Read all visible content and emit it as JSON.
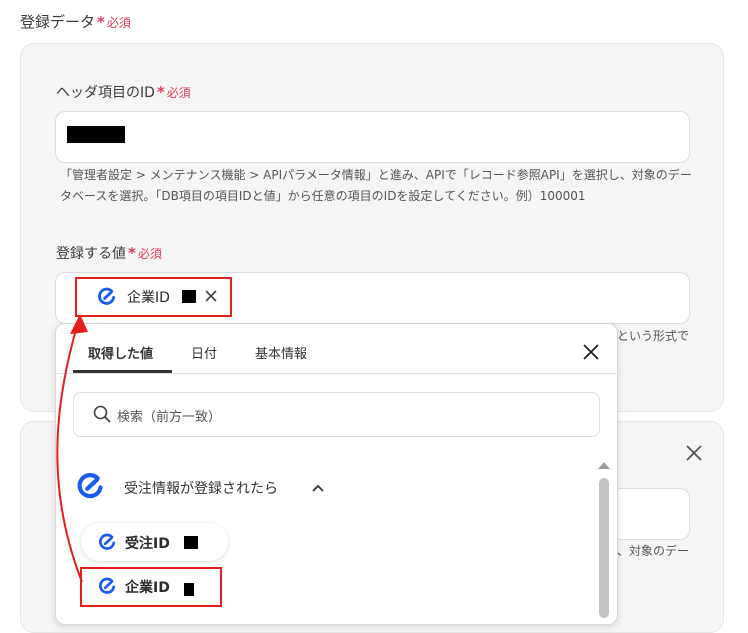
{
  "section": {
    "title": "登録データ",
    "required_label": "必須"
  },
  "header_id": {
    "label": "ヘッダ項目のID",
    "required_label": "必須",
    "hint_line1": "「管理者設定 > メンテナンス機能 > APIパラメータ情報」と進み、APIで「レコード参照API」を選択し、対象のデー",
    "hint_line2": "タベースを選択。「DB項目の項目IDと値」から任意の項目のIDを設定してください。例）100001"
  },
  "value_field": {
    "label": "登録する値",
    "required_label": "必須",
    "chip_label": "企業ID",
    "side_hint": "という形式で"
  },
  "second_panel": {
    "side_hint": "、対象のデー"
  },
  "dropdown": {
    "tabs": [
      {
        "label": "取得した値",
        "active": true
      },
      {
        "label": "日付",
        "active": false
      },
      {
        "label": "基本情報",
        "active": false
      }
    ],
    "search_placeholder": "検索（前方一致）",
    "group_title": "受注情報が登録されたら",
    "items": [
      {
        "label": "受注ID"
      },
      {
        "label": "企業ID"
      }
    ]
  },
  "colors": {
    "accent": "#1a5cf0",
    "required": "#e03e5a",
    "highlight": "#e51d1d"
  },
  "icons": [
    "yoom-c-icon",
    "close-icon",
    "search-icon",
    "chevron-up-icon",
    "scroll-up-arrow-icon"
  ]
}
